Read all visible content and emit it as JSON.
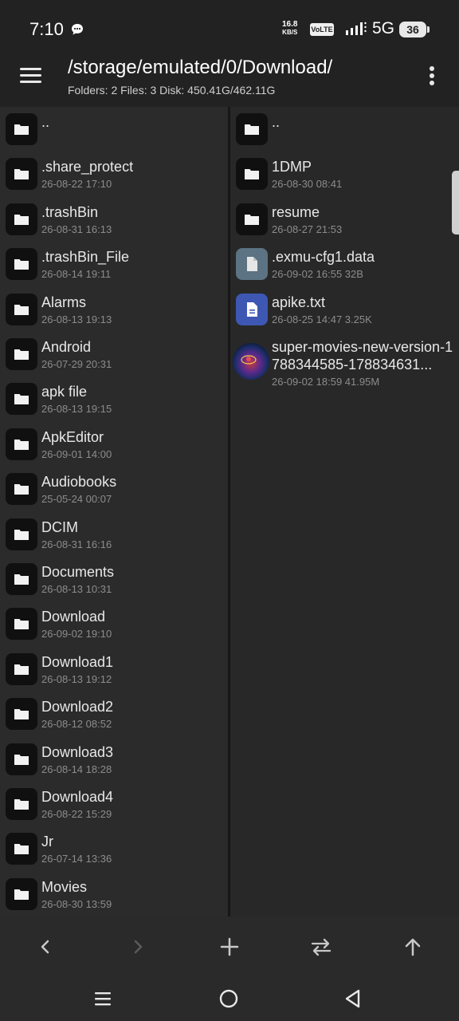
{
  "status_bar": {
    "time": "7:10",
    "net_speed_value": "16.8",
    "net_speed_unit": "KB/S",
    "volte": "VoLTE",
    "network": "5G",
    "battery": "36"
  },
  "header": {
    "path": "/storage/emulated/0/Download/",
    "summary": "Folders: 2  Files: 3  Disk: 450.41G/462.11G"
  },
  "left_pane": {
    "items": [
      {
        "name": "..",
        "meta": "",
        "type": "folder"
      },
      {
        "name": ".share_protect",
        "meta": "26-08-22 17:10",
        "type": "folder"
      },
      {
        "name": ".trashBin",
        "meta": "26-08-31 16:13",
        "type": "folder"
      },
      {
        "name": ".trashBin_File",
        "meta": "26-08-14 19:11",
        "type": "folder"
      },
      {
        "name": "Alarms",
        "meta": "26-08-13 19:13",
        "type": "folder"
      },
      {
        "name": "Android",
        "meta": "26-07-29 20:31",
        "type": "folder"
      },
      {
        "name": "apk file",
        "meta": "26-08-13 19:15",
        "type": "folder"
      },
      {
        "name": "ApkEditor",
        "meta": "26-09-01 14:00",
        "type": "folder"
      },
      {
        "name": "Audiobooks",
        "meta": "25-05-24 00:07",
        "type": "folder"
      },
      {
        "name": "DCIM",
        "meta": "26-08-31 16:16",
        "type": "folder"
      },
      {
        "name": "Documents",
        "meta": "26-08-13 10:31",
        "type": "folder"
      },
      {
        "name": "Download",
        "meta": "26-09-02 19:10",
        "type": "folder"
      },
      {
        "name": "Download1",
        "meta": "26-08-13 19:12",
        "type": "folder"
      },
      {
        "name": "Download2",
        "meta": "26-08-12 08:52",
        "type": "folder"
      },
      {
        "name": "Download3",
        "meta": "26-08-14 18:28",
        "type": "folder"
      },
      {
        "name": "Download4",
        "meta": "26-08-22 15:29",
        "type": "folder"
      },
      {
        "name": "Jr",
        "meta": "26-07-14 13:36",
        "type": "folder"
      },
      {
        "name": "Movies",
        "meta": "26-08-30 13:59",
        "type": "folder"
      }
    ]
  },
  "right_pane": {
    "items": [
      {
        "name": "..",
        "meta": "",
        "type": "folder"
      },
      {
        "name": "1DMP",
        "meta": "26-08-30 08:41",
        "type": "folder"
      },
      {
        "name": "resume",
        "meta": "26-08-27 21:53",
        "type": "folder"
      },
      {
        "name": ".exmu-cfg1.data",
        "meta": "26-09-02 16:55  32B",
        "type": "data"
      },
      {
        "name": "apike.txt",
        "meta": "26-08-25 14:47  3.25K",
        "type": "text"
      },
      {
        "name": "super-movies-new-version-1788344585-178834631...",
        "meta": "26-09-02 18:59  41.95M",
        "type": "image"
      }
    ]
  },
  "colors": {
    "background": "#1f1f1f",
    "pane_left": "#2b2b2b",
    "pane_right": "#282828",
    "text_primary": "#e8e8e8",
    "text_secondary": "#8c8c8c",
    "data_icon": "#5b7382",
    "text_icon": "#3d57b3"
  },
  "toolbar": {
    "icons": [
      "back-icon",
      "forward-icon",
      "add-icon",
      "swap-icon",
      "up-icon"
    ]
  },
  "nav_bar": {
    "icons": [
      "recents-icon",
      "home-icon",
      "back-triangle-icon"
    ]
  }
}
